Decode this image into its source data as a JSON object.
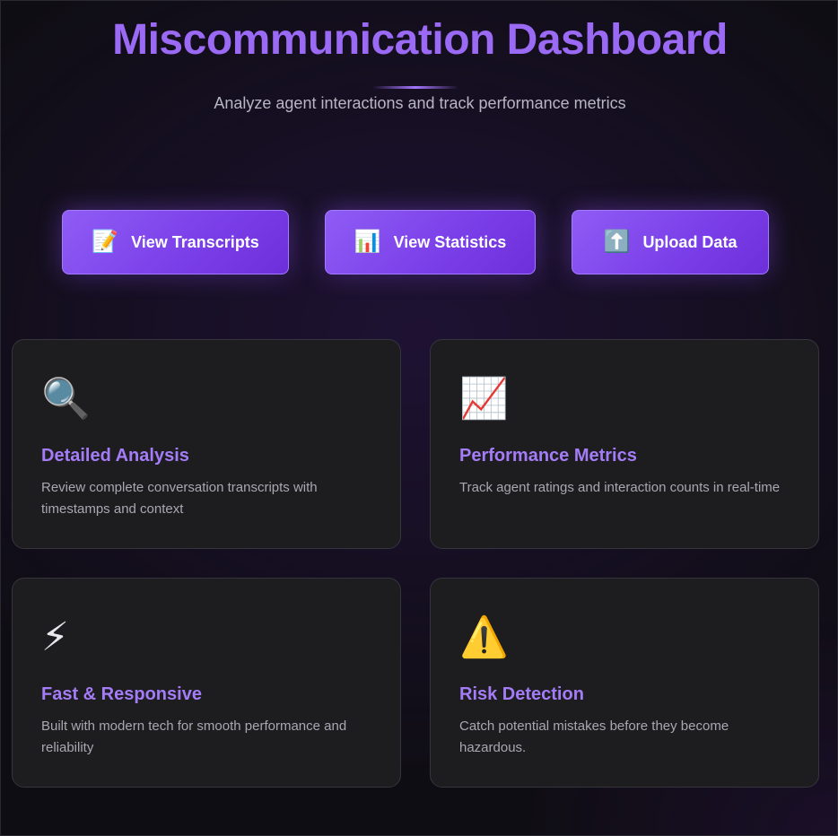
{
  "header": {
    "title": "Miscommunication Dashboard",
    "subtitle": "Analyze agent interactions and track performance metrics"
  },
  "actions": [
    {
      "icon": "📝",
      "icon_name": "memo-icon",
      "label": "View Transcripts"
    },
    {
      "icon": "📊",
      "icon_name": "bar-chart-icon",
      "label": "View Statistics"
    },
    {
      "icon": "⬆️",
      "icon_name": "upload-arrow-icon",
      "label": "Upload Data"
    }
  ],
  "features": [
    {
      "icon": "🔍",
      "icon_name": "magnifier-icon",
      "title": "Detailed Analysis",
      "description": "Review complete conversation transcripts with timestamps and context"
    },
    {
      "icon": "📈",
      "icon_name": "trending-chart-icon",
      "title": "Performance Metrics",
      "description": "Track agent ratings and interaction counts in real-time"
    },
    {
      "icon": "⚡",
      "icon_name": "lightning-icon",
      "title": "Fast & Responsive",
      "description": "Built with modern tech for smooth performance and reliability"
    },
    {
      "icon": "⚠️",
      "icon_name": "warning-icon",
      "title": "Risk Detection",
      "description": "Catch potential mistakes before they become hazardous."
    }
  ],
  "colors": {
    "accent": "#9b6af5",
    "button_gradient_start": "#8f5cf5",
    "button_gradient_end": "#6d2fd9",
    "card_background": "#1d1d1f",
    "page_background": "#0f0d14"
  }
}
